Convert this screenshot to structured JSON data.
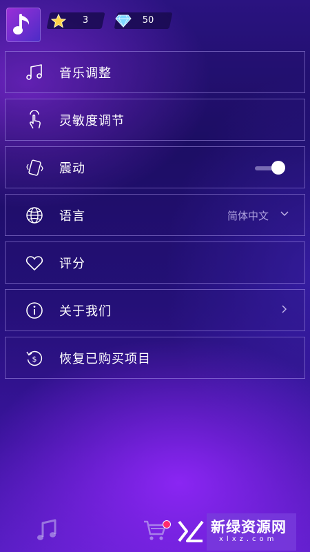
{
  "header": {
    "stars_count": "3",
    "gems_count": "50"
  },
  "menu": {
    "items": [
      {
        "label": "音乐调整",
        "icon": "music-notes-icon"
      },
      {
        "label": "灵敏度调节",
        "icon": "touch-gesture-icon"
      },
      {
        "label": "震动",
        "icon": "phone-vibrate-icon",
        "toggle_on": true
      },
      {
        "label": "语言",
        "icon": "globe-icon",
        "value": "简体中文"
      },
      {
        "label": "评分",
        "icon": "heart-icon"
      },
      {
        "label": "关于我们",
        "icon": "info-icon"
      },
      {
        "label": "恢复已购买项目",
        "icon": "restore-purchase-icon"
      }
    ]
  },
  "bottom_nav": {
    "items": [
      {
        "icon": "music-note-icon"
      },
      {
        "icon": "shopping-cart-icon",
        "badge": true
      }
    ]
  },
  "watermark": {
    "title": "新绿资源网",
    "subtitle": "xlxz.com"
  },
  "colors": {
    "accent": "#8f2cff",
    "background_top": "#2a1380",
    "background_bottom": "#5a1ec6",
    "badge": "#ff2a6e"
  }
}
